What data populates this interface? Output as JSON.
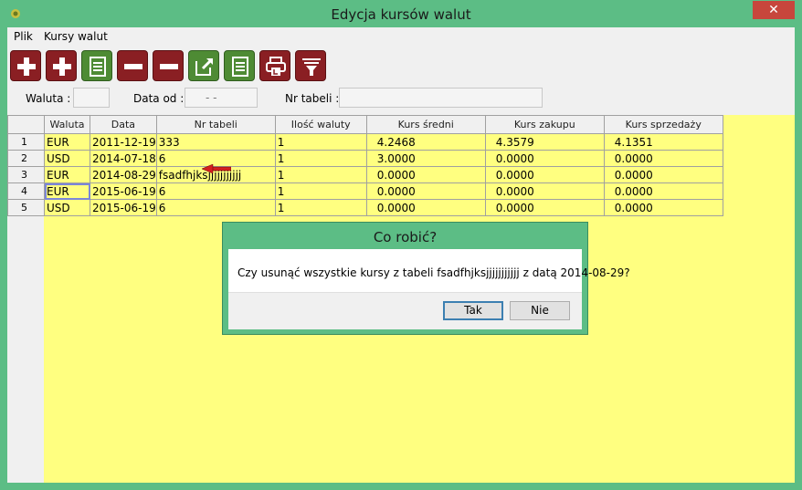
{
  "window": {
    "title": "Edycja kursów walut",
    "close_glyph": "✕"
  },
  "menu": [
    {
      "label": "Plik"
    },
    {
      "label": "Kursy walut"
    }
  ],
  "toolbar": [
    {
      "icon": "add-icon",
      "color": "#8a1f23"
    },
    {
      "icon": "add-icon",
      "color": "#8a1f23"
    },
    {
      "icon": "document-icon",
      "color": "#4e8b34"
    },
    {
      "icon": "remove-icon",
      "color": "#8a1f23"
    },
    {
      "icon": "remove-icon",
      "color": "#8a1f23"
    },
    {
      "icon": "edit-icon",
      "color": "#4e8b34"
    },
    {
      "icon": "document-icon",
      "color": "#4e8b34"
    },
    {
      "icon": "print-icon",
      "color": "#8a1f23"
    },
    {
      "icon": "filter-icon",
      "color": "#8a1f23"
    }
  ],
  "filters": {
    "waluta_label": "Waluta :",
    "waluta_value": "",
    "data_od_label": "Data od :",
    "data_od_value": "-  -",
    "nr_tabeli_label": "Nr tabeli :",
    "nr_tabeli_value": ""
  },
  "grid": {
    "columns": [
      "Waluta",
      "Data",
      "Nr tabeli",
      "Ilość waluty",
      "Kurs średni",
      "Kurs zakupu",
      "Kurs sprzedaży"
    ],
    "rows": [
      {
        "n": "1",
        "waluta": "EUR",
        "data": "2011-12-19",
        "nr": "333",
        "ilosc": "1",
        "sredni": "4.2468",
        "zakupu": "4.3579",
        "sprzedazy": "4.1351"
      },
      {
        "n": "2",
        "waluta": "USD",
        "data": "2014-07-18",
        "nr": "6",
        "ilosc": "1",
        "sredni": "3.0000",
        "zakupu": "0.0000",
        "sprzedazy": "0.0000"
      },
      {
        "n": "3",
        "waluta": "EUR",
        "data": "2014-08-29",
        "nr": "fsadfhjksjjjjjjjjjjj",
        "ilosc": "1",
        "sredni": "0.0000",
        "zakupu": "0.0000",
        "sprzedazy": "0.0000"
      },
      {
        "n": "4",
        "waluta": "EUR",
        "data": "2015-06-19",
        "nr": "6",
        "ilosc": "1",
        "sredni": "0.0000",
        "zakupu": "0.0000",
        "sprzedazy": "0.0000"
      },
      {
        "n": "5",
        "waluta": "USD",
        "data": "2015-06-19",
        "nr": "6",
        "ilosc": "1",
        "sredni": "0.0000",
        "zakupu": "0.0000",
        "sprzedazy": "0.0000"
      }
    ],
    "background": "#ffff80"
  },
  "dialog": {
    "title": "Co robić?",
    "message": "Czy usunąć wszystkie kursy z tabeli fsadfhjksjjjjjjjjjjj z datą 2014-08-29?",
    "yes_label": "Tak",
    "no_label": "Nie"
  },
  "colors": {
    "frame": "#5cbd85",
    "red_button": "#8a1f23",
    "green_button": "#4e8b34"
  }
}
